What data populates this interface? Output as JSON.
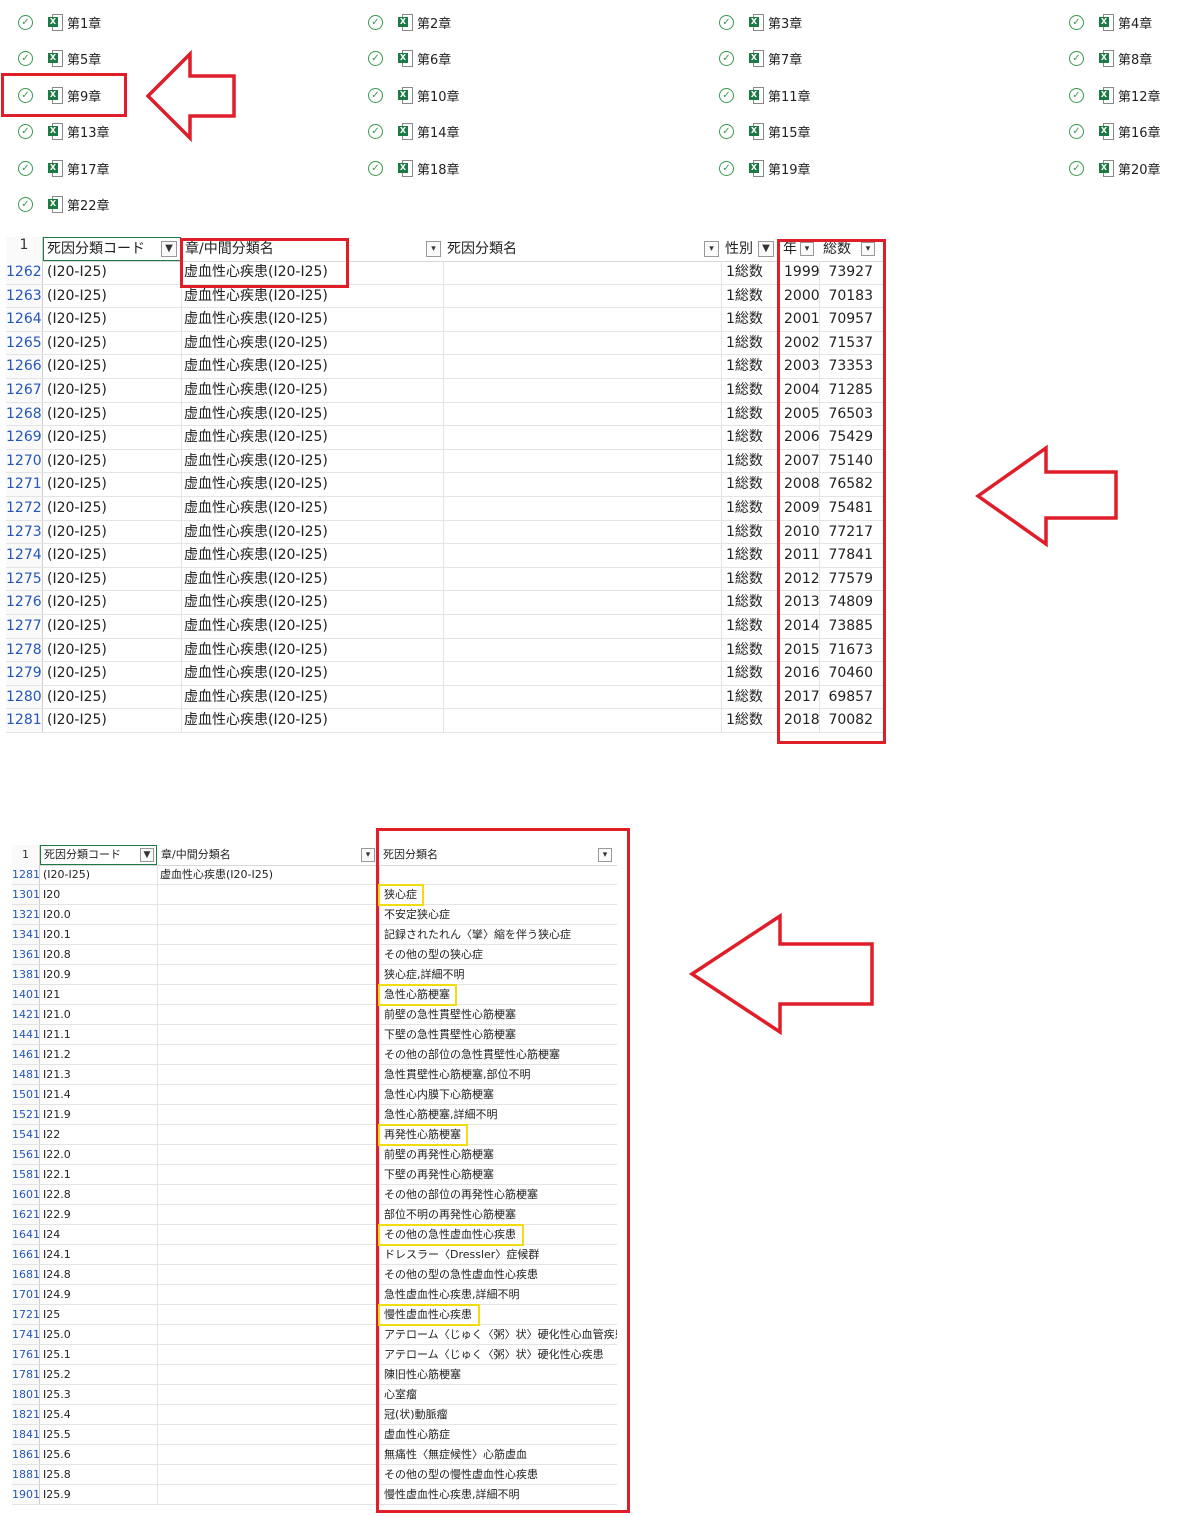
{
  "files": [
    {
      "name": "第1章"
    },
    {
      "name": "第2章"
    },
    {
      "name": "第3章"
    },
    {
      "name": "第4章"
    },
    {
      "name": "第5章"
    },
    {
      "name": "第6章"
    },
    {
      "name": "第7章"
    },
    {
      "name": "第8章"
    },
    {
      "name": "第9章"
    },
    {
      "name": "第10章"
    },
    {
      "name": "第11章"
    },
    {
      "name": "第12章"
    },
    {
      "name": "第13章"
    },
    {
      "name": "第14章"
    },
    {
      "name": "第15章"
    },
    {
      "name": "第16章"
    },
    {
      "name": "第17章"
    },
    {
      "name": "第18章"
    },
    {
      "name": "第19章"
    },
    {
      "name": "第20章"
    },
    {
      "name": "第22章"
    }
  ],
  "icons": {
    "check": "check-circle-icon",
    "excel": "excel-file-icon",
    "filter": "filter-icon",
    "dropdown": "dropdown-arrow-icon"
  },
  "colors": {
    "annotation_red": "#e01e2a",
    "highlight_yellow": "#f0dc10",
    "excel_green": "#1e7a45",
    "row_number_blue": "#2457b8"
  },
  "sheet1": {
    "header_row": "1",
    "headers": {
      "code": "死因分類コード",
      "chapter": "章/中間分類名",
      "name": "死因分類名",
      "sex": "性別",
      "year": "年",
      "total": "総数"
    },
    "rows": [
      {
        "row": "1262",
        "code": "(I20-I25)",
        "chapter": "虚血性心疾患(I20-I25)",
        "sex": "1総数",
        "year": "1999",
        "total": "73927"
      },
      {
        "row": "1263",
        "code": "(I20-I25)",
        "chapter": "虚血性心疾患(I20-I25)",
        "sex": "1総数",
        "year": "2000",
        "total": "70183"
      },
      {
        "row": "1264",
        "code": "(I20-I25)",
        "chapter": "虚血性心疾患(I20-I25)",
        "sex": "1総数",
        "year": "2001",
        "total": "70957"
      },
      {
        "row": "1265",
        "code": "(I20-I25)",
        "chapter": "虚血性心疾患(I20-I25)",
        "sex": "1総数",
        "year": "2002",
        "total": "71537"
      },
      {
        "row": "1266",
        "code": "(I20-I25)",
        "chapter": "虚血性心疾患(I20-I25)",
        "sex": "1総数",
        "year": "2003",
        "total": "73353"
      },
      {
        "row": "1267",
        "code": "(I20-I25)",
        "chapter": "虚血性心疾患(I20-I25)",
        "sex": "1総数",
        "year": "2004",
        "total": "71285"
      },
      {
        "row": "1268",
        "code": "(I20-I25)",
        "chapter": "虚血性心疾患(I20-I25)",
        "sex": "1総数",
        "year": "2005",
        "total": "76503"
      },
      {
        "row": "1269",
        "code": "(I20-I25)",
        "chapter": "虚血性心疾患(I20-I25)",
        "sex": "1総数",
        "year": "2006",
        "total": "75429"
      },
      {
        "row": "1270",
        "code": "(I20-I25)",
        "chapter": "虚血性心疾患(I20-I25)",
        "sex": "1総数",
        "year": "2007",
        "total": "75140"
      },
      {
        "row": "1271",
        "code": "(I20-I25)",
        "chapter": "虚血性心疾患(I20-I25)",
        "sex": "1総数",
        "year": "2008",
        "total": "76582"
      },
      {
        "row": "1272",
        "code": "(I20-I25)",
        "chapter": "虚血性心疾患(I20-I25)",
        "sex": "1総数",
        "year": "2009",
        "total": "75481"
      },
      {
        "row": "1273",
        "code": "(I20-I25)",
        "chapter": "虚血性心疾患(I20-I25)",
        "sex": "1総数",
        "year": "2010",
        "total": "77217"
      },
      {
        "row": "1274",
        "code": "(I20-I25)",
        "chapter": "虚血性心疾患(I20-I25)",
        "sex": "1総数",
        "year": "2011",
        "total": "77841"
      },
      {
        "row": "1275",
        "code": "(I20-I25)",
        "chapter": "虚血性心疾患(I20-I25)",
        "sex": "1総数",
        "year": "2012",
        "total": "77579"
      },
      {
        "row": "1276",
        "code": "(I20-I25)",
        "chapter": "虚血性心疾患(I20-I25)",
        "sex": "1総数",
        "year": "2013",
        "total": "74809"
      },
      {
        "row": "1277",
        "code": "(I20-I25)",
        "chapter": "虚血性心疾患(I20-I25)",
        "sex": "1総数",
        "year": "2014",
        "total": "73885"
      },
      {
        "row": "1278",
        "code": "(I20-I25)",
        "chapter": "虚血性心疾患(I20-I25)",
        "sex": "1総数",
        "year": "2015",
        "total": "71673"
      },
      {
        "row": "1279",
        "code": "(I20-I25)",
        "chapter": "虚血性心疾患(I20-I25)",
        "sex": "1総数",
        "year": "2016",
        "total": "70460"
      },
      {
        "row": "1280",
        "code": "(I20-I25)",
        "chapter": "虚血性心疾患(I20-I25)",
        "sex": "1総数",
        "year": "2017",
        "total": "69857"
      },
      {
        "row": "1281",
        "code": "(I20-I25)",
        "chapter": "虚血性心疾患(I20-I25)",
        "sex": "1総数",
        "year": "2018",
        "total": "70082"
      }
    ]
  },
  "sheet2": {
    "header_row": "1",
    "headers": {
      "code": "死因分類コード",
      "chapter": "章/中間分類名",
      "name": "死因分類名"
    },
    "rows": [
      {
        "row": "1281",
        "code": "(I20-I25)",
        "chapter": "虚血性心疾患(I20-I25)",
        "name": "",
        "highlight": false
      },
      {
        "row": "1301",
        "code": "I20",
        "chapter": "",
        "name": "狭心症",
        "highlight": true
      },
      {
        "row": "1321",
        "code": "I20.0",
        "chapter": "",
        "name": "不安定狭心症",
        "highlight": false
      },
      {
        "row": "1341",
        "code": "I20.1",
        "chapter": "",
        "name": "記録されたれん〈攣〉縮を伴う狭心症",
        "highlight": false
      },
      {
        "row": "1361",
        "code": "I20.8",
        "chapter": "",
        "name": "その他の型の狭心症",
        "highlight": false
      },
      {
        "row": "1381",
        "code": "I20.9",
        "chapter": "",
        "name": "狭心症,詳細不明",
        "highlight": false
      },
      {
        "row": "1401",
        "code": "I21",
        "chapter": "",
        "name": "急性心筋梗塞",
        "highlight": true
      },
      {
        "row": "1421",
        "code": "I21.0",
        "chapter": "",
        "name": "前壁の急性貫壁性心筋梗塞",
        "highlight": false
      },
      {
        "row": "1441",
        "code": "I21.1",
        "chapter": "",
        "name": "下壁の急性貫壁性心筋梗塞",
        "highlight": false
      },
      {
        "row": "1461",
        "code": "I21.2",
        "chapter": "",
        "name": "その他の部位の急性貫壁性心筋梗塞",
        "highlight": false
      },
      {
        "row": "1481",
        "code": "I21.3",
        "chapter": "",
        "name": "急性貫壁性心筋梗塞,部位不明",
        "highlight": false
      },
      {
        "row": "1501",
        "code": "I21.4",
        "chapter": "",
        "name": "急性心内膜下心筋梗塞",
        "highlight": false
      },
      {
        "row": "1521",
        "code": "I21.9",
        "chapter": "",
        "name": "急性心筋梗塞,詳細不明",
        "highlight": false
      },
      {
        "row": "1541",
        "code": "I22",
        "chapter": "",
        "name": "再発性心筋梗塞",
        "highlight": true
      },
      {
        "row": "1561",
        "code": "I22.0",
        "chapter": "",
        "name": "前壁の再発性心筋梗塞",
        "highlight": false
      },
      {
        "row": "1581",
        "code": "I22.1",
        "chapter": "",
        "name": "下壁の再発性心筋梗塞",
        "highlight": false
      },
      {
        "row": "1601",
        "code": "I22.8",
        "chapter": "",
        "name": "その他の部位の再発性心筋梗塞",
        "highlight": false
      },
      {
        "row": "1621",
        "code": "I22.9",
        "chapter": "",
        "name": "部位不明の再発性心筋梗塞",
        "highlight": false
      },
      {
        "row": "1641",
        "code": "I24",
        "chapter": "",
        "name": "その他の急性虚血性心疾患",
        "highlight": true
      },
      {
        "row": "1661",
        "code": "I24.1",
        "chapter": "",
        "name": "ドレスラー〈Dressler〉症候群",
        "highlight": false
      },
      {
        "row": "1681",
        "code": "I24.8",
        "chapter": "",
        "name": "その他の型の急性虚血性心疾患",
        "highlight": false
      },
      {
        "row": "1701",
        "code": "I24.9",
        "chapter": "",
        "name": "急性虚血性心疾患,詳細不明",
        "highlight": false
      },
      {
        "row": "1721",
        "code": "I25",
        "chapter": "",
        "name": "慢性虚血性心疾患",
        "highlight": true
      },
      {
        "row": "1741",
        "code": "I25.0",
        "chapter": "",
        "name": "アテローム〈じゅく〈粥〉状〉硬化性心血管疾患",
        "highlight": false
      },
      {
        "row": "1761",
        "code": "I25.1",
        "chapter": "",
        "name": "アテローム〈じゅく〈粥〉状〉硬化性心疾患",
        "highlight": false
      },
      {
        "row": "1781",
        "code": "I25.2",
        "chapter": "",
        "name": "陳旧性心筋梗塞",
        "highlight": false
      },
      {
        "row": "1801",
        "code": "I25.3",
        "chapter": "",
        "name": "心室瘤",
        "highlight": false
      },
      {
        "row": "1821",
        "code": "I25.4",
        "chapter": "",
        "name": "冠(状)動脈瘤",
        "highlight": false
      },
      {
        "row": "1841",
        "code": "I25.5",
        "chapter": "",
        "name": "虚血性心筋症",
        "highlight": false
      },
      {
        "row": "1861",
        "code": "I25.6",
        "chapter": "",
        "name": "無痛性〈無症候性〉心筋虚血",
        "highlight": false
      },
      {
        "row": "1881",
        "code": "I25.8",
        "chapter": "",
        "name": "その他の型の慢性虚血性心疾患",
        "highlight": false
      },
      {
        "row": "1901",
        "code": "I25.9",
        "chapter": "",
        "name": "慢性虚血性心疾患,詳細不明",
        "highlight": false
      }
    ]
  }
}
